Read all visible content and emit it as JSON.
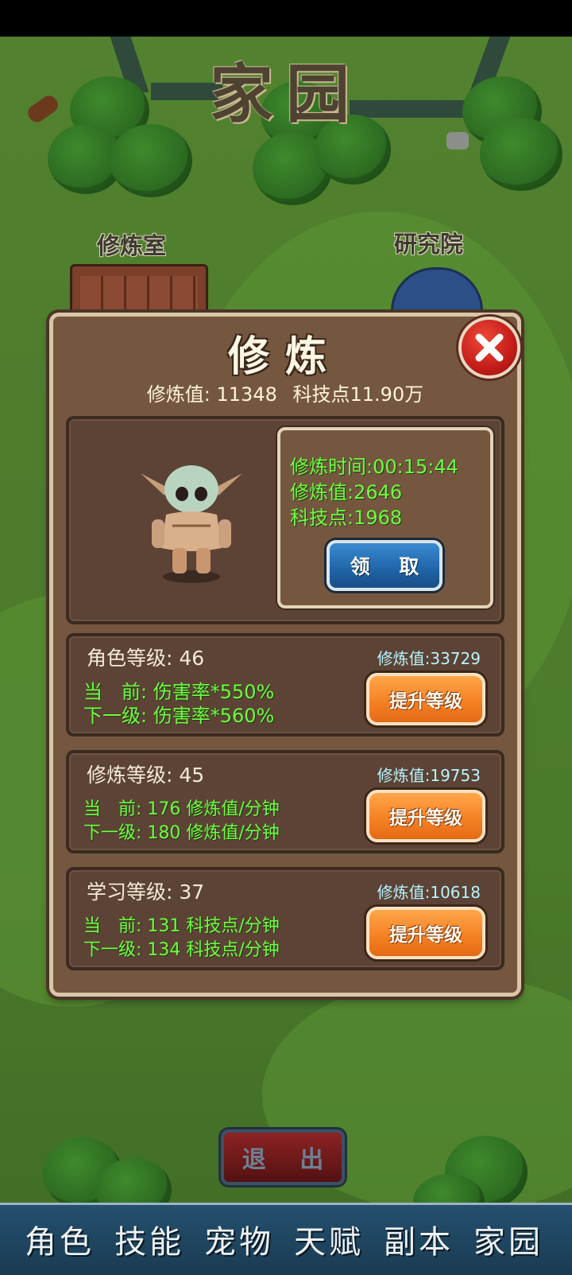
{
  "scene": {
    "title": "家园",
    "buildings": [
      "修炼室",
      "研究院"
    ]
  },
  "dialog": {
    "title": "修炼",
    "stats": {
      "cultivation_value": "修炼值: 11348",
      "tech_points": "科技点11.90万"
    },
    "close_icon": "close-icon",
    "status": {
      "time": "修炼时间:00:15:44",
      "cultivation": "修炼值:2646",
      "tech": "科技点:1968",
      "claim_label": "领 取"
    },
    "levels": [
      {
        "title": "角色等级: 46",
        "cost": "修炼值:33729",
        "current": "当　前: 伤害率*550%",
        "next": "下一级: 伤害率*560%",
        "button": "提升等级"
      },
      {
        "title": "修炼等级: 45",
        "cost": "修炼值:19753",
        "current": "当　前: 176 修炼值/分钟",
        "next": "下一级: 180 修炼值/分钟",
        "button": "提升等级"
      },
      {
        "title": "学习等级: 37",
        "cost": "修炼值:10618",
        "current": "当　前: 131 科技点/分钟",
        "next": "下一级: 134 科技点/分钟",
        "button": "提升等级"
      }
    ]
  },
  "exit_label": "退 出",
  "tabs": [
    "角色",
    "技能",
    "宠物",
    "天赋",
    "副本",
    "家园"
  ],
  "colors": {
    "dialog_bg": "#75573f",
    "green_text": "#6cff3e",
    "upgrade_button": "#f47f22",
    "claim_button": "#1f64a8",
    "close_button": "#c21d18"
  }
}
